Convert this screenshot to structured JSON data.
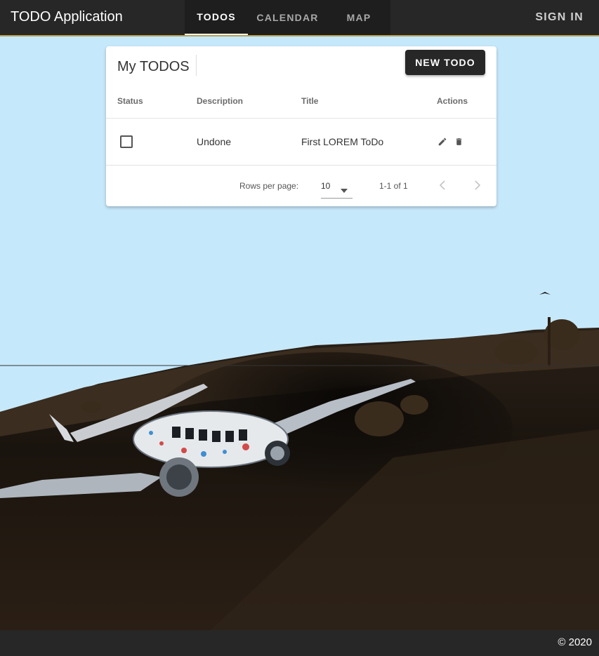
{
  "app": {
    "title": "TODO Application",
    "sign_in": "SIGN IN"
  },
  "tabs": [
    {
      "label": "TODOS",
      "active": true
    },
    {
      "label": "CALENDAR",
      "active": false
    },
    {
      "label": "MAP",
      "active": false
    }
  ],
  "card": {
    "title": "My TODOS",
    "new_button": "NEW TODO",
    "columns": [
      "Status",
      "Description",
      "Title",
      "Actions"
    ],
    "rows": [
      {
        "done": false,
        "description": "Undone",
        "title": "First LOREM ToDo",
        "actions": [
          "pencil-icon",
          "trash-icon"
        ]
      }
    ],
    "pagination": {
      "rows_per_page_label": "Rows per page:",
      "rows_per_page_value": "10",
      "range": "1-1 of 1"
    }
  },
  "footer": {
    "copyright": "© 2020"
  },
  "colors": {
    "appbar": "#272727",
    "sky": "#c6e8fb",
    "accent_line": "#b8a052",
    "button": "#272727"
  },
  "icons": [
    "pencil-icon",
    "trash-icon",
    "chevron-down-icon",
    "chevron-left-icon",
    "chevron-right-icon",
    "checkbox-icon"
  ]
}
